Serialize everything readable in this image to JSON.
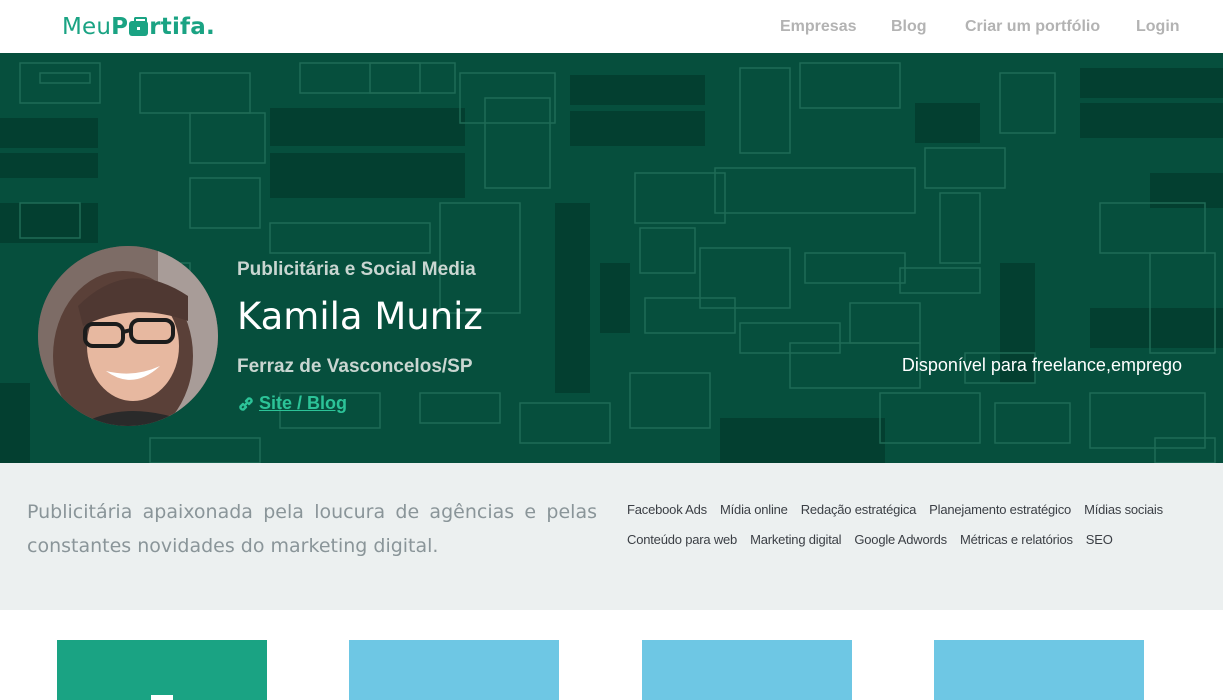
{
  "navbar": {
    "logo_light": "Meu",
    "logo_bold_start": "P",
    "logo_bold_end": "rtifa.",
    "links": [
      "Empresas",
      "Blog",
      "Criar um portfólio",
      "Login"
    ]
  },
  "profile": {
    "role": "Publicitária e Social Media",
    "name": "Kamila Muniz",
    "location": "Ferraz de Vasconcelos/SP",
    "site_link": "Site / Blog",
    "availability": "Disponível para freelance,emprego"
  },
  "about": {
    "bio": "Publicitária apaixonada pela loucura de agências e pelas constantes novidades do marketing digital.",
    "tags": [
      "Facebook Ads",
      "Mídia online",
      "Redação estratégica",
      "Planejamento estratégico",
      "Mídias sociais",
      "Conteúdo para web",
      "Marketing digital",
      "Google Adwords",
      "Métricas e relatórios",
      "SEO"
    ]
  },
  "colors": {
    "brand": "#1aa383",
    "hero_bg": "#064f3d",
    "link": "#2cc398",
    "thumb_green": "#1aa383",
    "thumb_blue": "#6ec7e4"
  },
  "portfolio": {
    "thumbnails": [
      {
        "color": "#1aa383",
        "icon": "image-icon"
      },
      {
        "color": "#6ec7e4",
        "icon": ""
      },
      {
        "color": "#6ec7e4",
        "icon": ""
      },
      {
        "color": "#6ec7e4",
        "icon": ""
      }
    ]
  }
}
